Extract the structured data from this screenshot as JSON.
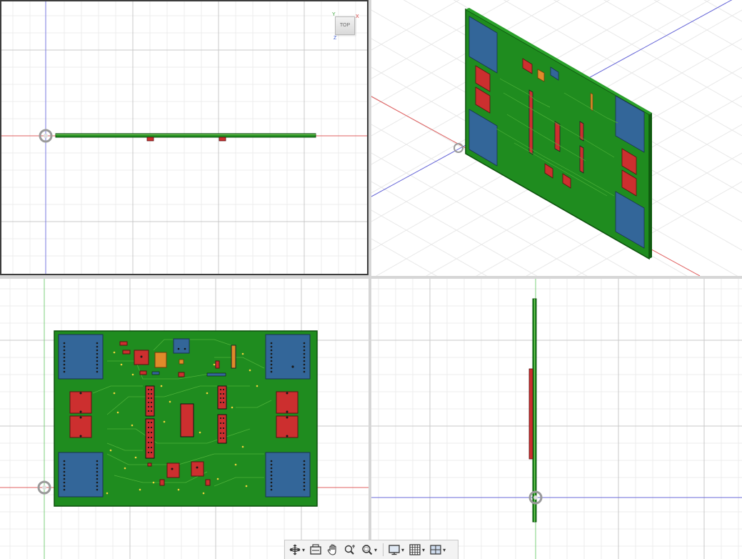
{
  "viewports": {
    "top": {
      "viewcube_label": "TOP",
      "axis_labels": {
        "x": "X",
        "y": "Y",
        "z": "Z"
      }
    },
    "isometric": {},
    "front": {},
    "right": {}
  },
  "toolbar": {
    "tools": [
      {
        "icon": "orbit-icon",
        "has_menu": true
      },
      {
        "icon": "look-at-icon",
        "has_menu": false
      },
      {
        "icon": "pan-hand-icon",
        "has_menu": false
      },
      {
        "icon": "zoom-icon",
        "has_menu": false
      },
      {
        "icon": "zoom-window-icon",
        "has_menu": true
      },
      {
        "icon": "display-settings-icon",
        "has_menu": true
      },
      {
        "icon": "grid-snap-icon",
        "has_menu": true
      },
      {
        "icon": "viewports-icon",
        "has_menu": true
      }
    ],
    "caret": "▾"
  },
  "colors": {
    "board": "#1f8c1f",
    "board_edge": "#0c4f0c",
    "trace": "#4fb23a",
    "relay_blue": "#336699",
    "relay_red": "#cc2f2f",
    "capacitor_orange": "#e08a2a",
    "grid_minor": "#ececec",
    "grid_major": "#c6c6c6",
    "axis_red": "#e06060",
    "axis_blue": "#6a6ad8",
    "axis_green": "#7cd07c"
  }
}
